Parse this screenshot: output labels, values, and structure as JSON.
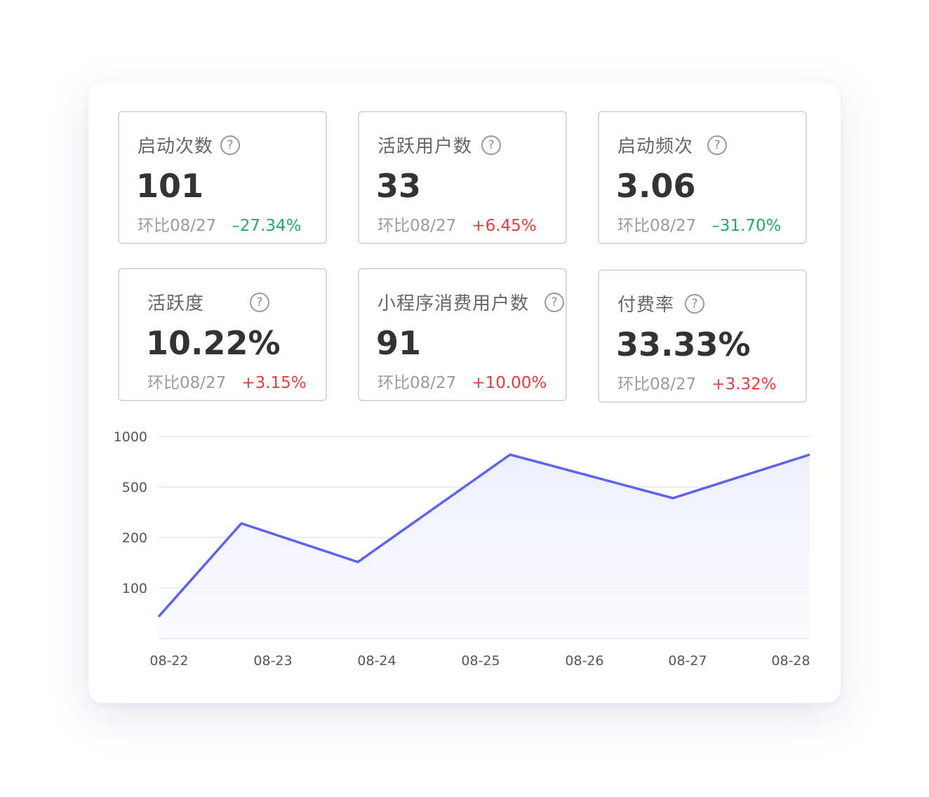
{
  "metrics": [
    {
      "title": "启动次数",
      "value": "101",
      "compare_label": "环比08/27",
      "change": "–27.34%",
      "trend": "down"
    },
    {
      "title": "活跃用户数",
      "value": "33",
      "compare_label": "环比08/27",
      "change": "+6.45%",
      "trend": "up"
    },
    {
      "title": "启动频次",
      "value": "3.06",
      "compare_label": "环比08/27",
      "change": "–31.70%",
      "trend": "down"
    },
    {
      "title": "活跃度",
      "value": "10.22%",
      "compare_label": "环比08/27",
      "change": "+3.15%",
      "trend": "up"
    },
    {
      "title": "小程序消费用户数",
      "value": "91",
      "compare_label": "环比08/27",
      "change": "+10.00%",
      "trend": "up"
    },
    {
      "title": "付费率",
      "value": "33.33%",
      "compare_label": "环比08/27",
      "change": "+3.32%",
      "trend": "up"
    }
  ],
  "help_glyph": "?",
  "help_icon": "question-circle-icon",
  "colors": {
    "line": "#5b63f0",
    "area": "#eef0fd",
    "down": "#1fae5b",
    "up": "#ee3a3a",
    "grid": "#e8e8ec"
  },
  "chart_data": {
    "type": "area",
    "categories": [
      "08-22",
      "08-23",
      "08-24",
      "08-25",
      "08-26",
      "08-27",
      "08-28"
    ],
    "x": [
      "08-22",
      "08-22/23",
      "08-23/24",
      "08-25",
      "08-26/27",
      "08-28"
    ],
    "series": [
      {
        "values": [
          60,
          250,
          150,
          650,
          400,
          650
        ]
      }
    ],
    "yscale": "log",
    "yticks": [
      "1000",
      "500",
      "200",
      "100"
    ],
    "ylim": [
      50,
      1000
    ],
    "grid": true
  }
}
